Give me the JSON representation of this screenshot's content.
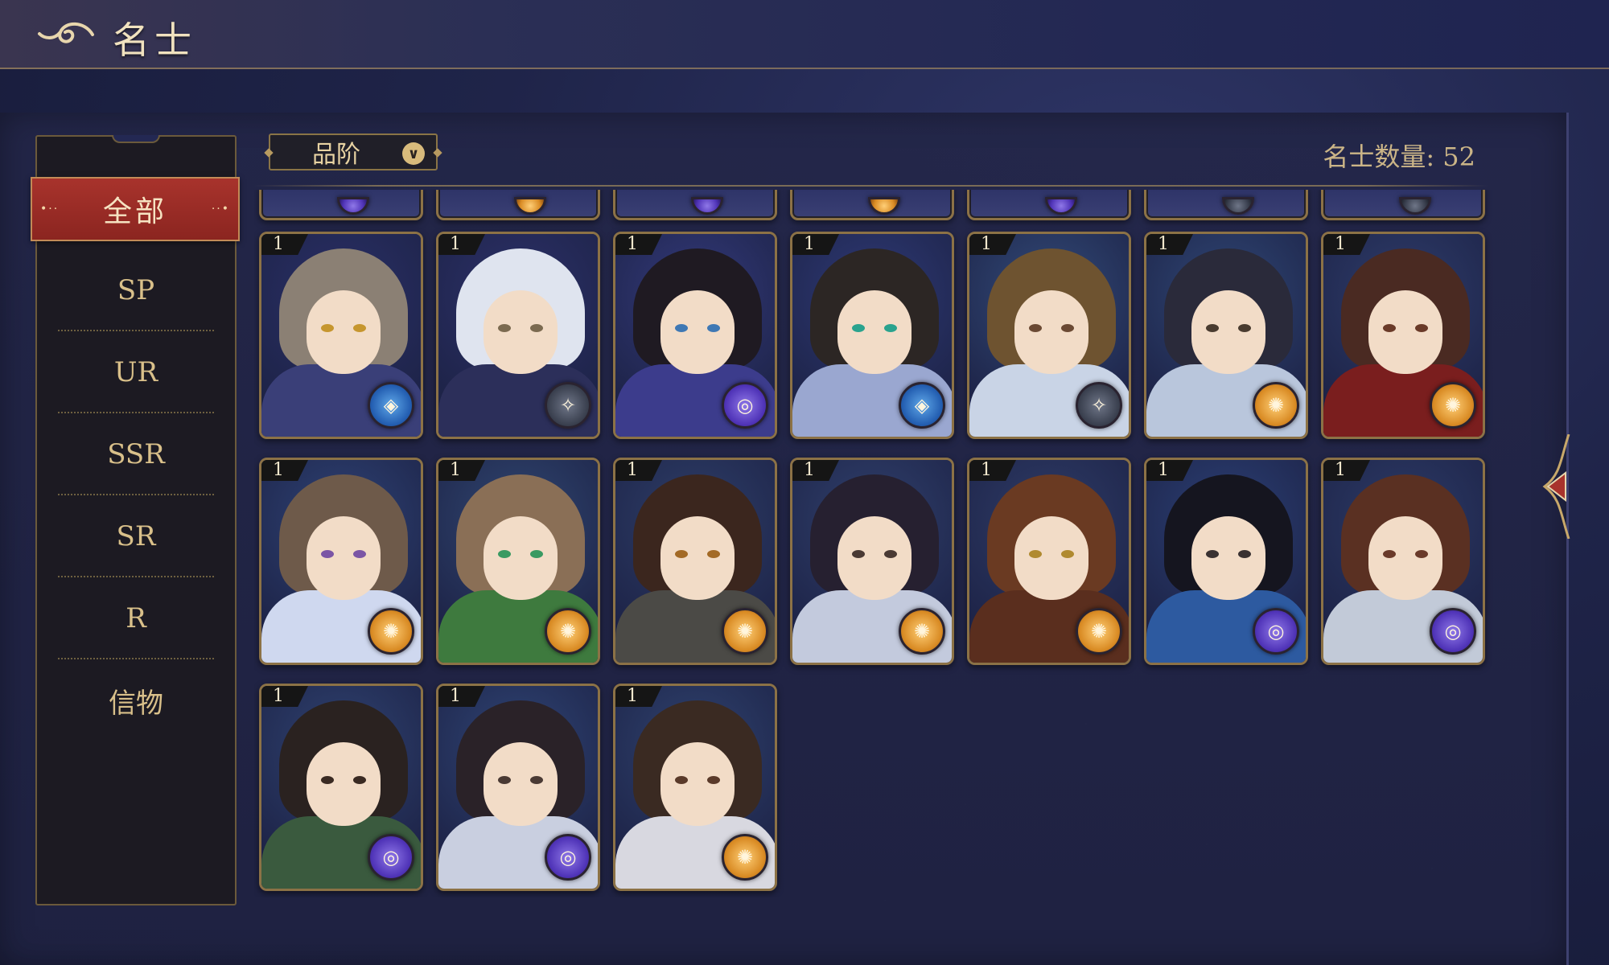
{
  "header": {
    "title": "名士"
  },
  "sidebar": {
    "items": [
      {
        "label": "全部",
        "active": true
      },
      {
        "label": "SP"
      },
      {
        "label": "UR"
      },
      {
        "label": "SSR"
      },
      {
        "label": "SR"
      },
      {
        "label": "R"
      },
      {
        "label": "信物"
      }
    ]
  },
  "filter": {
    "label": "品阶",
    "icon": "chevron-down-icon"
  },
  "count": {
    "text": "名士数量: 52"
  },
  "colors": {
    "accent_red": "#a8332c",
    "gold": "#d8bb7c",
    "badge_gold": "#d98b24",
    "badge_purple": "#5034b8",
    "badge_blue": "#245fb2",
    "badge_dark": "#3b4150"
  },
  "cards": [
    {
      "level": "1",
      "badge": "blue",
      "hair": "#8b8074",
      "body": "#3a3f78",
      "bg": "#2a2f66",
      "eyes": "#c6962e"
    },
    {
      "level": "1",
      "badge": "dark",
      "hair": "#dfe4ef",
      "body": "#2c2f5a",
      "bg": "#2c3068",
      "eyes": "#7b6a50"
    },
    {
      "level": "1",
      "badge": "purple",
      "hair": "#1f1a22",
      "body": "#3c3c8c",
      "bg": "#33397a",
      "eyes": "#3f78b4"
    },
    {
      "level": "1",
      "badge": "blue",
      "hair": "#2c2624",
      "body": "#9aa7d0",
      "bg": "#2e3975",
      "eyes": "#2aa38e"
    },
    {
      "level": "1",
      "badge": "dark",
      "hair": "#6e5330",
      "body": "#c9d4e6",
      "bg": "#324a78",
      "eyes": "#6b4a34"
    },
    {
      "level": "1",
      "badge": "gold",
      "hair": "#2a2a3a",
      "body": "#b9c6dc",
      "bg": "#2f4674",
      "eyes": "#4a3c30"
    },
    {
      "level": "1",
      "badge": "gold",
      "hair": "#4a2a22",
      "body": "#7a1e1e",
      "bg": "#2e3c6a",
      "eyes": "#6a3a28"
    },
    {
      "level": "1",
      "badge": "gold",
      "hair": "#6e5a4a",
      "body": "#cfd8ef",
      "bg": "#2e4274",
      "eyes": "#7b55a5"
    },
    {
      "level": "1",
      "badge": "gold",
      "hair": "#8a6f56",
      "body": "#3e7a3e",
      "bg": "#304670",
      "eyes": "#3a9a62"
    },
    {
      "level": "1",
      "badge": "gold",
      "hair": "#3b261e",
      "body": "#4b4a46",
      "bg": "#2e3e68",
      "eyes": "#a36a26"
    },
    {
      "level": "1",
      "badge": "gold",
      "hair": "#262030",
      "body": "#c3cadd",
      "bg": "#30406c",
      "eyes": "#4a3a34"
    },
    {
      "level": "1",
      "badge": "gold",
      "hair": "#6a3a22",
      "body": "#5a2e1e",
      "bg": "#2e3b66",
      "eyes": "#b08a30"
    },
    {
      "level": "1",
      "badge": "purple",
      "hair": "#15151f",
      "body": "#2d5aa0",
      "bg": "#2b3f74",
      "eyes": "#3a3232"
    },
    {
      "level": "1",
      "badge": "purple",
      "hair": "#5a3022",
      "body": "#c2cad8",
      "bg": "#2c3a66",
      "eyes": "#6a3a2a"
    },
    {
      "level": "1",
      "badge": "purple",
      "hair": "#2a2220",
      "body": "#3a5a3e",
      "bg": "#2f4270",
      "eyes": "#3a2a22"
    },
    {
      "level": "1",
      "badge": "purple",
      "hair": "#2a2228",
      "body": "#c9cfe0",
      "bg": "#2f4474",
      "eyes": "#4a3a34"
    },
    {
      "level": "1",
      "badge": "gold",
      "hair": "#3a2a22",
      "body": "#d8d8e0",
      "bg": "#2f426e",
      "eyes": "#5a3a2a"
    }
  ],
  "partial_badges": [
    "purple",
    "gold",
    "purple",
    "gold",
    "purple",
    "dark",
    "dark"
  ]
}
